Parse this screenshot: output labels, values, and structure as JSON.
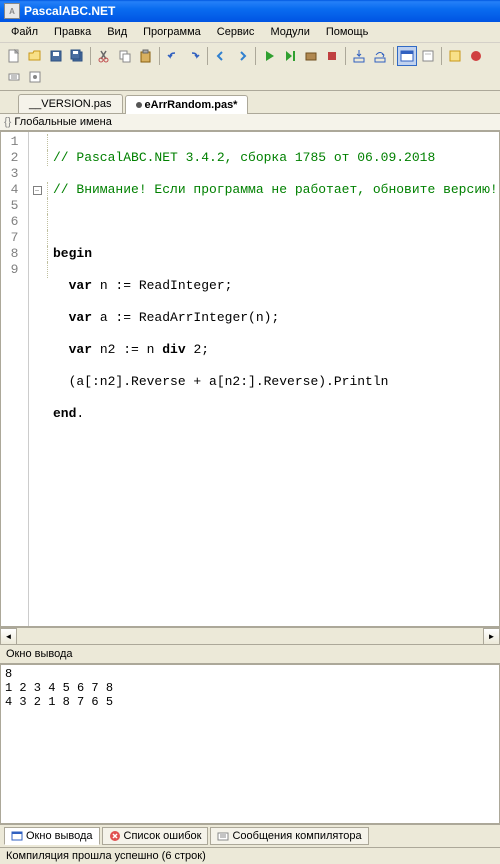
{
  "window": {
    "title": "PascalABC.NET"
  },
  "menu": {
    "file": "Файл",
    "edit": "Правка",
    "view": "Вид",
    "program": "Программа",
    "service": "Сервис",
    "modules": "Модули",
    "help": "Помощь"
  },
  "tabs": {
    "tab1": "__VERSION.pas",
    "tab2": "eArrRandom.pas*"
  },
  "breadcrumb": {
    "text": "Глобальные имена"
  },
  "code": {
    "lines": [
      "1",
      "2",
      "3",
      "4",
      "5",
      "6",
      "7",
      "8",
      "9"
    ],
    "l1": "// PascalABC.NET 3.4.2, сборка 1785 от 06.09.2018",
    "l2": "// Внимание! Если программа не работает, обновите версию!",
    "l3": "",
    "l4_kw": "begin",
    "l5a": "  ",
    "l5_kw": "var",
    "l5b": " n := ReadInteger;",
    "l6a": "  ",
    "l6_kw": "var",
    "l6b": " a := ReadArrInteger(n);",
    "l7a": "  ",
    "l7_kw": "var",
    "l7b": " n2 := n ",
    "l7_kw2": "div",
    "l7c": " 2;",
    "l8": "  (a[:n2].Reverse + a[n2:].Reverse).Println",
    "l9_kw": "end",
    "l9b": "."
  },
  "output": {
    "title": "Окно вывода",
    "content": "8\n1 2 3 4 5 6 7 8\n4 3 2 1 8 7 6 5"
  },
  "bottom_tabs": {
    "t1": "Окно вывода",
    "t2": "Список ошибок",
    "t3": "Сообщения компилятора"
  },
  "status": {
    "text": "Компиляция прошла успешно (6 строк)"
  }
}
